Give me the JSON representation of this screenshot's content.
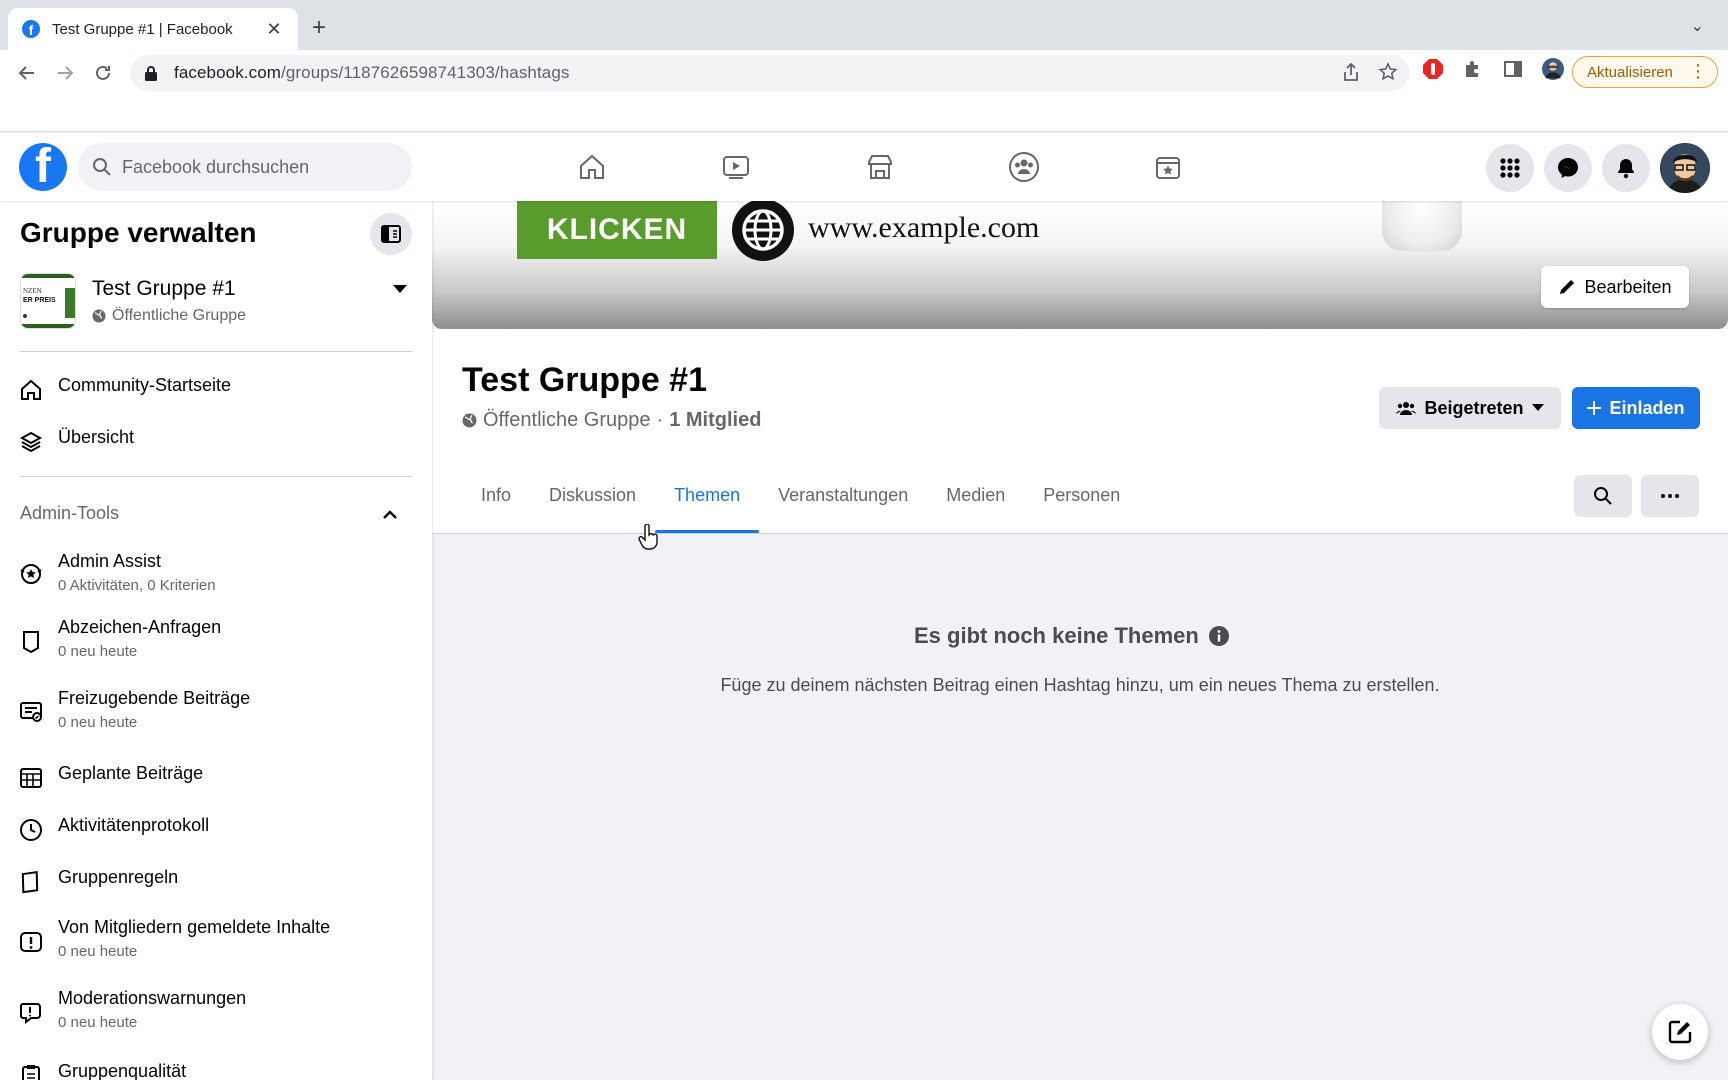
{
  "browser": {
    "tab_title": "Test Gruppe #1 | Facebook",
    "url_host": "facebook.com",
    "url_path": "/groups/1187626598741303/hashtags",
    "update_label": "Aktualisieren"
  },
  "fb_header": {
    "search_placeholder": "Facebook durchsuchen",
    "nav": [
      "home-icon",
      "video-icon",
      "marketplace-icon",
      "groups-icon",
      "gaming-icon"
    ],
    "brand_color": "#1877f2"
  },
  "sidebar": {
    "title": "Gruppe verwalten",
    "group_name": "Test Gruppe #1",
    "group_type": "Öffentliche Gruppe",
    "thumb_text": [
      "NZEN",
      "ER PREIS"
    ],
    "top_items": [
      {
        "label": "Community-Startseite",
        "icon": "home-icon"
      },
      {
        "label": "Übersicht",
        "icon": "layers-icon"
      }
    ],
    "admin_section": "Admin-Tools",
    "admin_items": [
      {
        "label": "Admin Assist",
        "sub": "0 Aktivitäten, 0 Kriterien",
        "icon": "admin-assist-icon"
      },
      {
        "label": "Abzeichen-Anfragen",
        "sub": "0 neu heute",
        "icon": "badge-icon"
      },
      {
        "label": "Freizugebende Beiträge",
        "sub": "0 neu heute",
        "icon": "pending-posts-icon"
      },
      {
        "label": "Geplante Beiträge",
        "sub": "",
        "icon": "calendar-icon"
      },
      {
        "label": "Aktivitätenprotokoll",
        "sub": "",
        "icon": "clock-icon"
      },
      {
        "label": "Gruppenregeln",
        "sub": "",
        "icon": "rules-icon"
      },
      {
        "label": "Von Mitgliedern gemeldete Inhalte",
        "sub": "0 neu heute",
        "icon": "report-icon"
      },
      {
        "label": "Moderationswarnungen",
        "sub": "0 neu heute",
        "icon": "warning-bubble-icon"
      },
      {
        "label": "Gruppenqualität",
        "sub": "",
        "icon": "clipboard-icon"
      }
    ]
  },
  "cover": {
    "cta": "KLICKEN",
    "website": "www.example.com",
    "edit_label": "Bearbeiten"
  },
  "group_header": {
    "title": "Test Gruppe #1",
    "privacy": "Öffentliche Gruppe",
    "separator": "·",
    "members": "1 Mitglied",
    "joined_label": "Beigetreten",
    "invite_label": "Einladen",
    "tabs": [
      "Info",
      "Diskussion",
      "Themen",
      "Veranstaltungen",
      "Medien",
      "Personen"
    ],
    "active_tab": "Themen"
  },
  "empty_state": {
    "title": "Es gibt noch keine Themen",
    "description": "Füge zu deinem nächsten Beitrag einen Hashtag hinzu, um ein neues Thema zu erstellen."
  },
  "colors": {
    "accent": "#1b74e4",
    "cta_green": "#5a9b2e",
    "update_orange": "#a15c00"
  }
}
